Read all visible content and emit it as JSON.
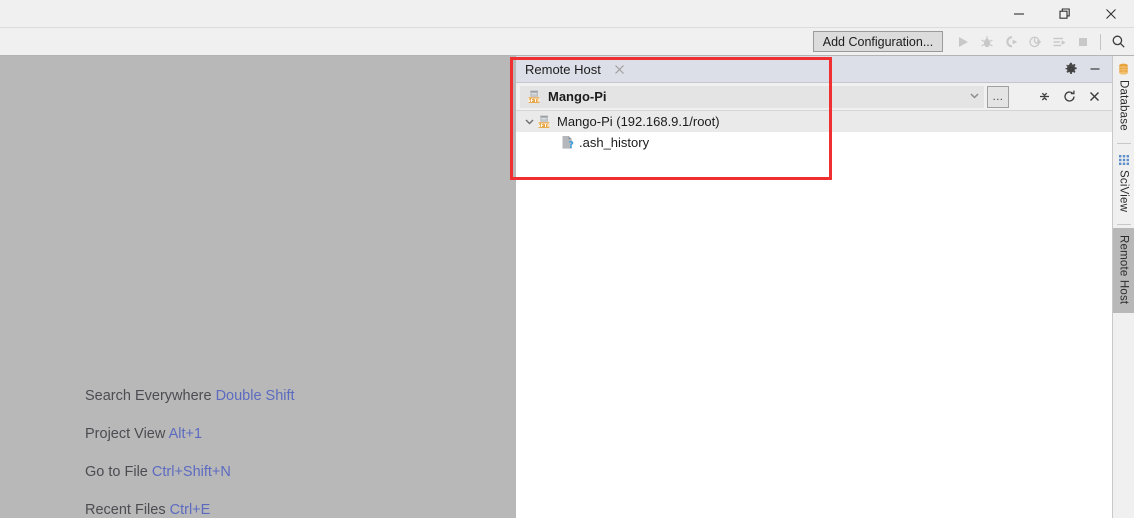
{
  "window": {
    "controls": [
      {
        "name": "minimize",
        "icon": "minimize-icon"
      },
      {
        "name": "restore",
        "icon": "restore-icon"
      },
      {
        "name": "close",
        "icon": "close-icon"
      }
    ]
  },
  "toolbar": {
    "add_configuration_label": "Add Configuration...",
    "icons": [
      {
        "name": "run-icon",
        "title": "Run"
      },
      {
        "name": "debug-icon",
        "title": "Debug"
      },
      {
        "name": "run-coverage-icon",
        "title": "Run with Coverage"
      },
      {
        "name": "profile-icon",
        "title": "Profile"
      },
      {
        "name": "run-with-args-icon",
        "title": "Run with Parameters"
      },
      {
        "name": "stop-icon",
        "title": "Stop"
      }
    ],
    "search_icon": "search-icon"
  },
  "welcome": {
    "rows": [
      {
        "label": "Search Everywhere",
        "shortcut": "Double Shift"
      },
      {
        "label": "Project View",
        "shortcut": "Alt+1"
      },
      {
        "label": "Go to File",
        "shortcut": "Ctrl+Shift+N"
      },
      {
        "label": "Recent Files",
        "shortcut": "Ctrl+E"
      }
    ]
  },
  "tool_window": {
    "tab_title": "Remote Host",
    "tab_close_icon": "close-icon",
    "header_icons": [
      {
        "name": "gear-icon",
        "title": "Settings"
      },
      {
        "name": "minimize-icon",
        "title": "Hide"
      }
    ],
    "toolbar_icons": [
      {
        "name": "collapse-all-icon",
        "title": "Collapse All"
      },
      {
        "name": "refresh-icon",
        "title": "Refresh"
      },
      {
        "name": "close-icon",
        "title": "Close"
      }
    ],
    "combo": {
      "selected": "Mango-Pi",
      "icon": "sftp-server-icon",
      "chevron_icon": "chevron-down-icon",
      "browse_label": "..."
    },
    "tree": [
      {
        "label": "Mango-Pi (192.168.9.1/root)",
        "icon": "sftp-server-icon",
        "expanded": true,
        "depth": 0,
        "chevron_icon": "chevron-down-icon"
      },
      {
        "label": ".ash_history",
        "icon": "unknown-file-icon",
        "expanded": false,
        "depth": 1,
        "chevron_icon": ""
      }
    ]
  },
  "right_rail": {
    "tabs": [
      {
        "label": "Database",
        "icon": "database-icon",
        "active": false
      },
      {
        "label": "SciView",
        "icon": "sciview-icon",
        "active": false
      },
      {
        "label": "Remote Host",
        "icon": "",
        "active": true
      }
    ]
  },
  "annotation": {
    "color": "#f03030"
  },
  "colors": {
    "titlebar": "#f0f0f0",
    "editor_grey": "#b8b8b8",
    "tool_header": "#dcdfe8",
    "accent_link": "#5c6bc0",
    "sftp_orange": "#e8a33d"
  }
}
